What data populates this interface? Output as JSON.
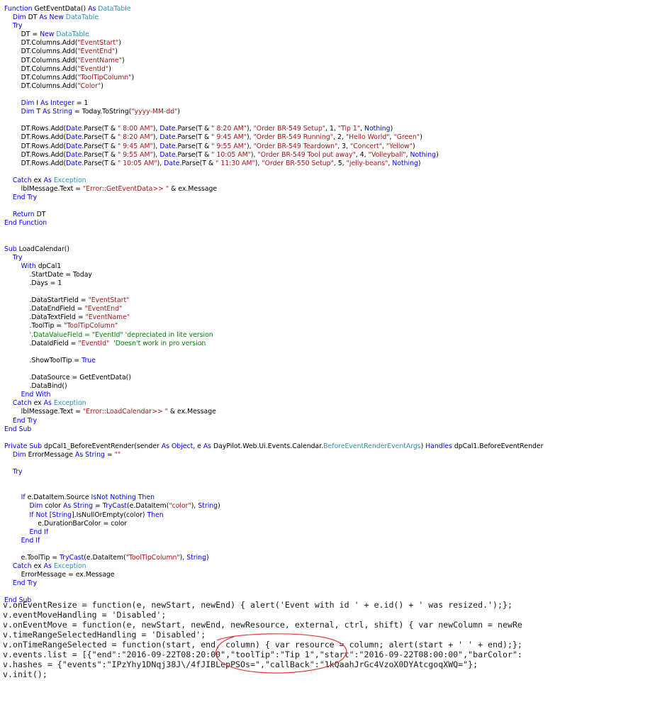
{
  "vb_code": [
    [
      [
        "kw",
        "Function "
      ],
      [
        "pl",
        "GetEventData() "
      ],
      [
        "kw",
        "As "
      ],
      [
        "ty",
        "DataTable"
      ]
    ],
    [
      [
        "pl",
        "    "
      ],
      [
        "kw",
        "Dim "
      ],
      [
        "pl",
        "DT "
      ],
      [
        "kw",
        "As New "
      ],
      [
        "ty",
        "DataTable"
      ]
    ],
    [
      [
        "pl",
        "    "
      ],
      [
        "kw",
        "Try"
      ]
    ],
    [
      [
        "pl",
        "        DT = "
      ],
      [
        "kw",
        "New "
      ],
      [
        "ty",
        "DataTable"
      ]
    ],
    [
      [
        "pl",
        "        DT.Columns.Add("
      ],
      [
        "st",
        "\"EventStart\""
      ],
      [
        "pl",
        ")"
      ]
    ],
    [
      [
        "pl",
        "        DT.Columns.Add("
      ],
      [
        "st",
        "\"EventEnd\""
      ],
      [
        "pl",
        ")"
      ]
    ],
    [
      [
        "pl",
        "        DT.Columns.Add("
      ],
      [
        "st",
        "\"EventName\""
      ],
      [
        "pl",
        ")"
      ]
    ],
    [
      [
        "pl",
        "        DT.Columns.Add("
      ],
      [
        "st",
        "\"EventId\""
      ],
      [
        "pl",
        ")"
      ]
    ],
    [
      [
        "pl",
        "        DT.Columns.Add("
      ],
      [
        "st",
        "\"ToolTipColumn\""
      ],
      [
        "pl",
        ")"
      ]
    ],
    [
      [
        "pl",
        "        DT.Columns.Add("
      ],
      [
        "st",
        "\"Color\""
      ],
      [
        "pl",
        ")"
      ]
    ],
    [],
    [
      [
        "pl",
        "        "
      ],
      [
        "kw",
        "Dim "
      ],
      [
        "pl",
        "I "
      ],
      [
        "kw",
        "As Integer "
      ],
      [
        "pl",
        "= 1"
      ]
    ],
    [
      [
        "pl",
        "        "
      ],
      [
        "kw",
        "Dim "
      ],
      [
        "pl",
        "T "
      ],
      [
        "kw",
        "As String "
      ],
      [
        "pl",
        "= Today.ToString("
      ],
      [
        "st",
        "\"yyyy-MM-dd\""
      ],
      [
        "pl",
        ")"
      ]
    ],
    [],
    [
      [
        "pl",
        "        DT.Rows.Add("
      ],
      [
        "kw",
        "Date"
      ],
      [
        "pl",
        ".Parse(T & "
      ],
      [
        "st",
        "\" 8:00 AM\""
      ],
      [
        "pl",
        "), "
      ],
      [
        "kw",
        "Date"
      ],
      [
        "pl",
        ".Parse(T & "
      ],
      [
        "st",
        "\" 8:20 AM\""
      ],
      [
        "pl",
        "), "
      ],
      [
        "st",
        "\"Order BR-549 Setup\""
      ],
      [
        "pl",
        ", 1, "
      ],
      [
        "st",
        "\"Tip 1\""
      ],
      [
        "pl",
        ", "
      ],
      [
        "kw",
        "Nothing"
      ],
      [
        "pl",
        ")"
      ]
    ],
    [
      [
        "pl",
        "        DT.Rows.Add("
      ],
      [
        "kw",
        "Date"
      ],
      [
        "pl",
        ".Parse(T & "
      ],
      [
        "st",
        "\" 8:20 AM\""
      ],
      [
        "pl",
        "), "
      ],
      [
        "kw",
        "Date"
      ],
      [
        "pl",
        ".Parse(T & "
      ],
      [
        "st",
        "\" 9:45 AM\""
      ],
      [
        "pl",
        "), "
      ],
      [
        "st",
        "\"Order BR-549 Running\""
      ],
      [
        "pl",
        ", 2, "
      ],
      [
        "st",
        "\"Hello World\""
      ],
      [
        "pl",
        ", "
      ],
      [
        "st",
        "\"Green\""
      ],
      [
        "pl",
        ")"
      ]
    ],
    [
      [
        "pl",
        "        DT.Rows.Add("
      ],
      [
        "kw",
        "Date"
      ],
      [
        "pl",
        ".Parse(T & "
      ],
      [
        "st",
        "\" 9:45 AM\""
      ],
      [
        "pl",
        "), "
      ],
      [
        "kw",
        "Date"
      ],
      [
        "pl",
        ".Parse(T & "
      ],
      [
        "st",
        "\" 9:55 AM\""
      ],
      [
        "pl",
        "), "
      ],
      [
        "st",
        "\"Order BR-549 Teardown\""
      ],
      [
        "pl",
        ", 3, "
      ],
      [
        "st",
        "\"Concert\""
      ],
      [
        "pl",
        ", "
      ],
      [
        "st",
        "\"Yellow\""
      ],
      [
        "pl",
        ")"
      ]
    ],
    [
      [
        "pl",
        "        DT.Rows.Add("
      ],
      [
        "kw",
        "Date"
      ],
      [
        "pl",
        ".Parse(T & "
      ],
      [
        "st",
        "\" 9:55 AM\""
      ],
      [
        "pl",
        "), "
      ],
      [
        "kw",
        "Date"
      ],
      [
        "pl",
        ".Parse(T & "
      ],
      [
        "st",
        "\" 10:05 AM\""
      ],
      [
        "pl",
        "), "
      ],
      [
        "st",
        "\"Order BR-549 Tool put away\""
      ],
      [
        "pl",
        ", 4, "
      ],
      [
        "st",
        "\"Volleyball\""
      ],
      [
        "pl",
        ", "
      ],
      [
        "kw",
        "Nothing"
      ],
      [
        "pl",
        ")"
      ]
    ],
    [
      [
        "pl",
        "        DT.Rows.Add("
      ],
      [
        "kw",
        "Date"
      ],
      [
        "pl",
        ".Parse(T & "
      ],
      [
        "st",
        "\" 10:05 AM\""
      ],
      [
        "pl",
        "), "
      ],
      [
        "kw",
        "Date"
      ],
      [
        "pl",
        ".Parse(T & "
      ],
      [
        "st",
        "\" 11:30 AM\""
      ],
      [
        "pl",
        "), "
      ],
      [
        "st",
        "\"Order BR-550 Setup\""
      ],
      [
        "pl",
        ", 5, "
      ],
      [
        "st",
        "\"jelly-beans\""
      ],
      [
        "pl",
        ", "
      ],
      [
        "kw",
        "Nothing"
      ],
      [
        "pl",
        ")"
      ]
    ],
    [],
    [
      [
        "pl",
        "    "
      ],
      [
        "kw",
        "Catch "
      ],
      [
        "pl",
        "ex "
      ],
      [
        "kw",
        "As "
      ],
      [
        "ty",
        "Exception"
      ]
    ],
    [
      [
        "pl",
        "        lblMessage.Text = "
      ],
      [
        "st",
        "\"Error::GetEventData>> \""
      ],
      [
        "pl",
        " & ex.Message"
      ]
    ],
    [
      [
        "pl",
        "    "
      ],
      [
        "kw",
        "End Try"
      ]
    ],
    [],
    [
      [
        "pl",
        "    "
      ],
      [
        "kw",
        "Return "
      ],
      [
        "pl",
        "DT"
      ]
    ],
    [
      [
        "kw",
        "End Function"
      ]
    ],
    [],
    [],
    [
      [
        "kw",
        "Sub "
      ],
      [
        "pl",
        "LoadCalendar()"
      ]
    ],
    [
      [
        "pl",
        "    "
      ],
      [
        "kw",
        "Try"
      ]
    ],
    [
      [
        "pl",
        "        "
      ],
      [
        "kw",
        "With "
      ],
      [
        "pl",
        "dpCal1"
      ]
    ],
    [
      [
        "pl",
        "            .StartDate = Today"
      ]
    ],
    [
      [
        "pl",
        "            .Days = 1"
      ]
    ],
    [],
    [
      [
        "pl",
        "            .DataStartField = "
      ],
      [
        "st",
        "\"EventStart\""
      ]
    ],
    [
      [
        "pl",
        "            .DataEndField = "
      ],
      [
        "st",
        "\"EventEnd\""
      ]
    ],
    [
      [
        "pl",
        "            .DataTextField = "
      ],
      [
        "st",
        "\"EventName\""
      ]
    ],
    [
      [
        "pl",
        "            .ToolTip = "
      ],
      [
        "st",
        "\"ToolTipColumn\""
      ]
    ],
    [
      [
        "pl",
        "            "
      ],
      [
        "cm",
        "'.DataValueField = \"EventId\" 'depreciated in lite version"
      ]
    ],
    [
      [
        "pl",
        "            .DataIdField = "
      ],
      [
        "st",
        "\"EventId\""
      ],
      [
        "pl",
        "  "
      ],
      [
        "cm",
        "'Doesn't work in pro version"
      ]
    ],
    [],
    [
      [
        "pl",
        "            .ShowToolTip = "
      ],
      [
        "kw",
        "True"
      ]
    ],
    [],
    [
      [
        "pl",
        "            .DataSource = GetEventData()"
      ]
    ],
    [
      [
        "pl",
        "            .DataBind()"
      ]
    ],
    [
      [
        "pl",
        "        "
      ],
      [
        "kw",
        "End With"
      ]
    ],
    [
      [
        "pl",
        "    "
      ],
      [
        "kw",
        "Catch "
      ],
      [
        "pl",
        "ex "
      ],
      [
        "kw",
        "As "
      ],
      [
        "ty",
        "Exception"
      ]
    ],
    [
      [
        "pl",
        "        lblMessage.Text = "
      ],
      [
        "st",
        "\"Error::LoadCalendar>> \""
      ],
      [
        "pl",
        " & ex.Message"
      ]
    ],
    [
      [
        "pl",
        "    "
      ],
      [
        "kw",
        "End Try"
      ]
    ],
    [
      [
        "kw",
        "End Sub"
      ]
    ],
    [],
    [
      [
        "kw",
        "Private Sub "
      ],
      [
        "pl",
        "dpCal1_BeforeEventRender(sender "
      ],
      [
        "kw",
        "As Object"
      ],
      [
        "pl",
        ", e "
      ],
      [
        "kw",
        "As "
      ],
      [
        "pl",
        "DayPilot.Web.Ui.Events.Calendar."
      ],
      [
        "ty",
        "BeforeEventRenderEventArgs"
      ],
      [
        "pl",
        ") "
      ],
      [
        "kw",
        "Handles "
      ],
      [
        "pl",
        "dpCal1.BeforeEventRender"
      ]
    ],
    [
      [
        "pl",
        "    "
      ],
      [
        "kw",
        "Dim "
      ],
      [
        "pl",
        "ErrorMessage "
      ],
      [
        "kw",
        "As String "
      ],
      [
        "pl",
        "= "
      ],
      [
        "st",
        "\"\""
      ]
    ],
    [],
    [
      [
        "pl",
        "    "
      ],
      [
        "kw",
        "Try"
      ]
    ],
    [],
    [],
    [
      [
        "pl",
        "        "
      ],
      [
        "kw",
        "If "
      ],
      [
        "pl",
        "e.DataItem.Source "
      ],
      [
        "kw",
        "IsNot Nothing Then"
      ]
    ],
    [
      [
        "pl",
        "            "
      ],
      [
        "kw",
        "Dim "
      ],
      [
        "pl",
        "color "
      ],
      [
        "kw",
        "As String "
      ],
      [
        "pl",
        "= "
      ],
      [
        "kw",
        "TryCast"
      ],
      [
        "pl",
        "(e.DataItem("
      ],
      [
        "st",
        "\"color\""
      ],
      [
        "pl",
        "), "
      ],
      [
        "kw",
        "String"
      ],
      [
        "pl",
        ")"
      ]
    ],
    [
      [
        "pl",
        "            "
      ],
      [
        "kw",
        "If Not "
      ],
      [
        "pl",
        "["
      ],
      [
        "kw",
        "String"
      ],
      [
        "pl",
        "].IsNullOrEmpty(color) "
      ],
      [
        "kw",
        "Then"
      ]
    ],
    [
      [
        "pl",
        "                e.DurationBarColor = color"
      ]
    ],
    [
      [
        "pl",
        "            "
      ],
      [
        "kw",
        "End If"
      ]
    ],
    [
      [
        "pl",
        "        "
      ],
      [
        "kw",
        "End If"
      ]
    ],
    [],
    [
      [
        "pl",
        "        e.ToolTip = "
      ],
      [
        "kw",
        "TryCast"
      ],
      [
        "pl",
        "(e.DataItem("
      ],
      [
        "st",
        "\"ToolTipColumn\""
      ],
      [
        "pl",
        "), "
      ],
      [
        "kw",
        "String"
      ],
      [
        "pl",
        ")"
      ]
    ],
    [
      [
        "pl",
        "    "
      ],
      [
        "kw",
        "Catch "
      ],
      [
        "pl",
        "ex "
      ],
      [
        "kw",
        "As "
      ],
      [
        "ty",
        "Exception"
      ]
    ],
    [
      [
        "pl",
        "        ErrorMessage = ex.Message"
      ]
    ],
    [
      [
        "pl",
        "    "
      ],
      [
        "kw",
        "End Try"
      ]
    ],
    [],
    [
      [
        "kw",
        "End Sub"
      ]
    ]
  ],
  "js_output": [
    "v.onEventResize = function(e, newStart, newEnd) { alert('Event with id ' + e.id() + ' was resized.');};",
    "v.eventMoveHandling = 'Disabled';",
    "v.onEventMove = function(e, newStart, newEnd, newResource, external, ctrl, shift) { var newColumn = newRe",
    "v.timeRangeSelectedHandling = 'Disabled';",
    "v.onTimeRangeSelected = function(start, end, column) { var resource = column; alert(start + ' ' + end);};",
    "v.events.list = [{\"end\":\"2016-09-22T08:20:00\",\"toolTip\":\"Tip 1\",\"start\":\"2016-09-22T08:00:00\",\"barColor\":",
    "v.hashes = {\"events\":\"IPzYhy1DNqj38J\\/4fJIBLepPSOs=\",\"callBack\":\"1kQaahJrGc4VzoX0DYAtcgoqXWQ=\"};",
    "v.init();"
  ],
  "colors": {
    "keyword": "#0000ff",
    "type": "#2b91af",
    "string": "#a31515",
    "comment": "#008000",
    "annotation": "#e03c3c"
  }
}
